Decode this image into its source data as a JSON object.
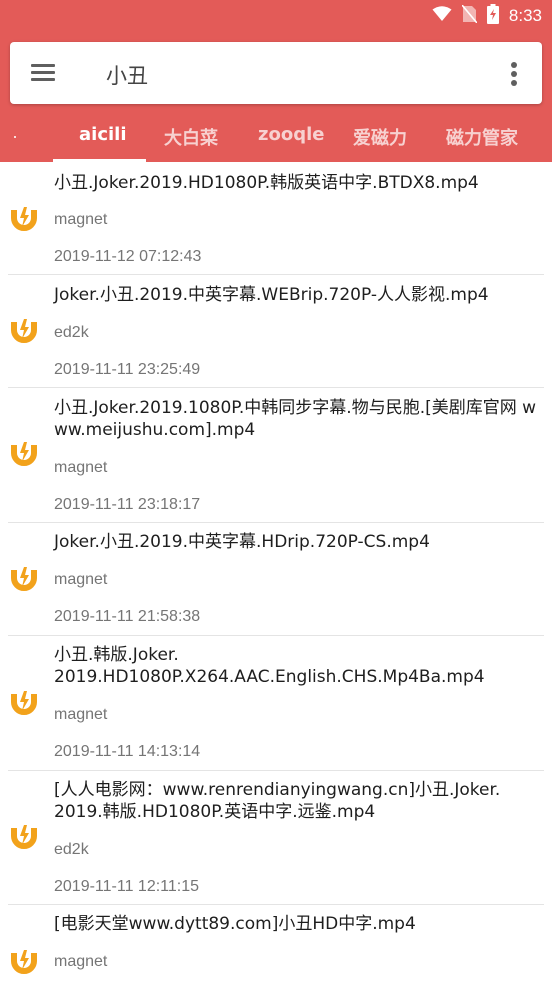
{
  "status_bar": {
    "time": "8:33",
    "icons": [
      "wifi-icon",
      "no-sim-icon",
      "battery-charging-icon"
    ]
  },
  "search": {
    "query": "小丑"
  },
  "tabs": [
    {
      "label": "aicili",
      "active": true
    },
    {
      "label": "大白菜",
      "active": false
    },
    {
      "label": "zooqle",
      "active": false
    },
    {
      "label": "爱磁力",
      "active": false
    },
    {
      "label": "磁力管家",
      "active": false
    }
  ],
  "results": [
    {
      "title": "小丑.Joker.2019.HD1080P.韩版英语中字.BTDX8.mp4",
      "type": "magnet",
      "date": "2019-11-12 07:12:43"
    },
    {
      "title": "Joker.小丑.2019.中英字幕.WEBrip.720P-人人影视.mp4",
      "type": "ed2k",
      "date": "2019-11-11 23:25:49"
    },
    {
      "title": "小丑.Joker.2019.1080P.中韩同步字幕.物与民胞.[美剧库官网 www.meijushu.com].mp4",
      "type": "magnet",
      "date": "2019-11-11 23:18:17"
    },
    {
      "title": "Joker.小丑.2019.中英字幕.HDrip.720P-CS.mp4",
      "type": "magnet",
      "date": "2019-11-11 21:58:38"
    },
    {
      "title": "小丑.韩版.Joker.\n2019.HD1080P.X264.AAC.English.CHS.Mp4Ba.mp4",
      "type": "magnet",
      "date": "2019-11-11 14:13:14"
    },
    {
      "title": "[人人电影网：www.renrendianyingwang.cn]小丑.Joker.\n2019.韩版.HD1080P.英语中字.远鉴.mp4",
      "type": "ed2k",
      "date": "2019-11-11 12:11:15"
    },
    {
      "title": "[电影天堂www.dytt89.com]小丑HD中字.mp4",
      "type": "magnet",
      "date": ""
    }
  ],
  "colors": {
    "header": "#e35b58",
    "magnet_icon": "#f2a21b",
    "divider": "#e4e4e4"
  }
}
